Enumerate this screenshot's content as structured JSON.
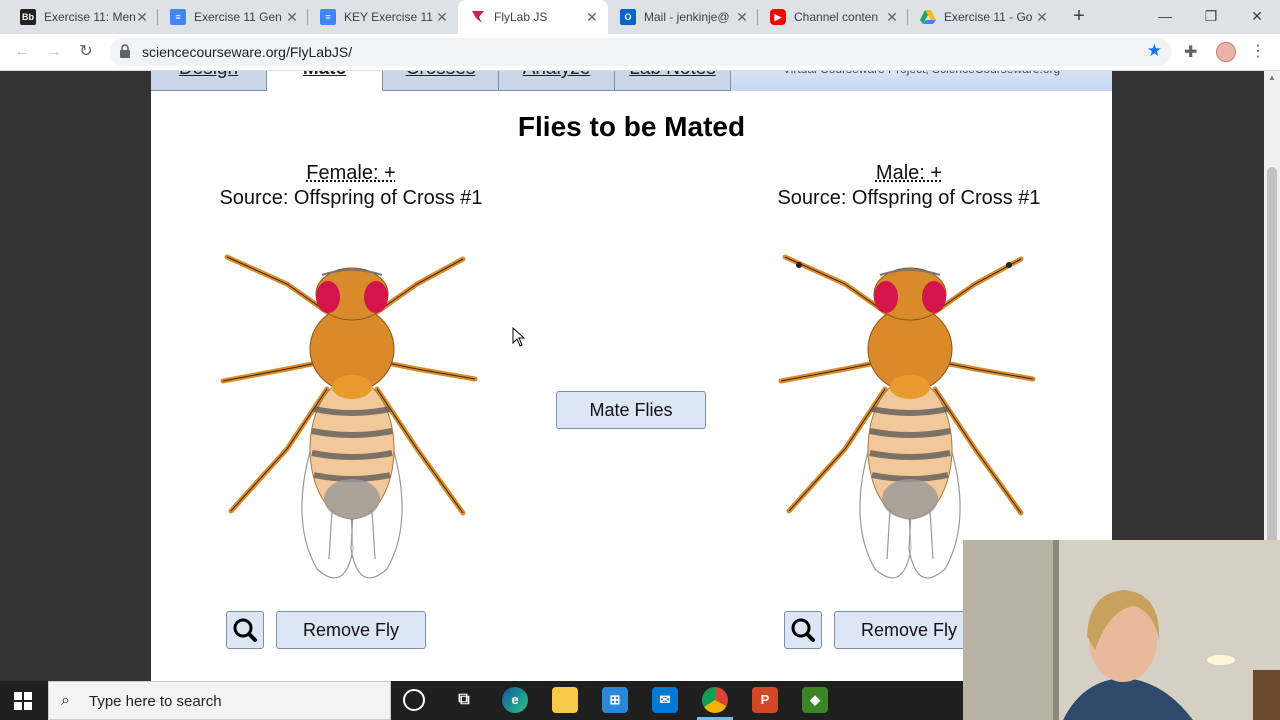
{
  "browser": {
    "tabs": [
      {
        "title": "Exercise 11: Men",
        "icon": "blackboard-icon",
        "color": "#222222",
        "glyph": "Bb"
      },
      {
        "title": "Exercise 11 Gen",
        "icon": "google-docs-icon",
        "color": "#4285f4",
        "glyph": ""
      },
      {
        "title": "KEY Exercise 11",
        "icon": "google-docs-icon",
        "color": "#4285f4",
        "glyph": ""
      },
      {
        "title": "FlyLab JS",
        "icon": "flylab-icon",
        "color": "#cc2244",
        "glyph": ""
      },
      {
        "title": "Mail - jenkinje@",
        "icon": "outlook-icon",
        "color": "#0a64c8",
        "glyph": "O"
      },
      {
        "title": "Channel conten",
        "icon": "youtube-icon",
        "color": "#ff0000",
        "glyph": ""
      },
      {
        "title": "Exercise 11 - Go",
        "icon": "google-drive-icon",
        "color": "#1fa463",
        "glyph": ""
      }
    ],
    "active_tab": 3,
    "url": "sciencecourseware.org/FlyLabJS/"
  },
  "app": {
    "tabs": [
      "Design",
      "Mate",
      "Crosses",
      "Analyze",
      "Lab Notes"
    ],
    "active_tab": 1,
    "credit": "Virtual Courseware Project, ScienceCourseware.org",
    "title": "Flies to be Mated",
    "female": {
      "label": "Female: +",
      "source": "Source: Offspring of Cross #1"
    },
    "male": {
      "label": "Male: +",
      "source": "Source: Offspring of Cross #1"
    },
    "mate_button": "Mate Flies",
    "remove_button": "Remove Fly"
  },
  "taskbar": {
    "search_placeholder": "Type here to search",
    "apps": [
      "cortana-icon",
      "task-view-icon",
      "edge-icon",
      "file-explorer-icon",
      "store-icon",
      "mail-icon",
      "chrome-icon",
      "powerpoint-icon",
      "minecraft-education-icon"
    ]
  },
  "colors": {
    "fly_body": "#d98a2b",
    "fly_eye": "#d4144a",
    "button_bg": "#dde6f5",
    "tab_bar": "#c9d6e8"
  }
}
